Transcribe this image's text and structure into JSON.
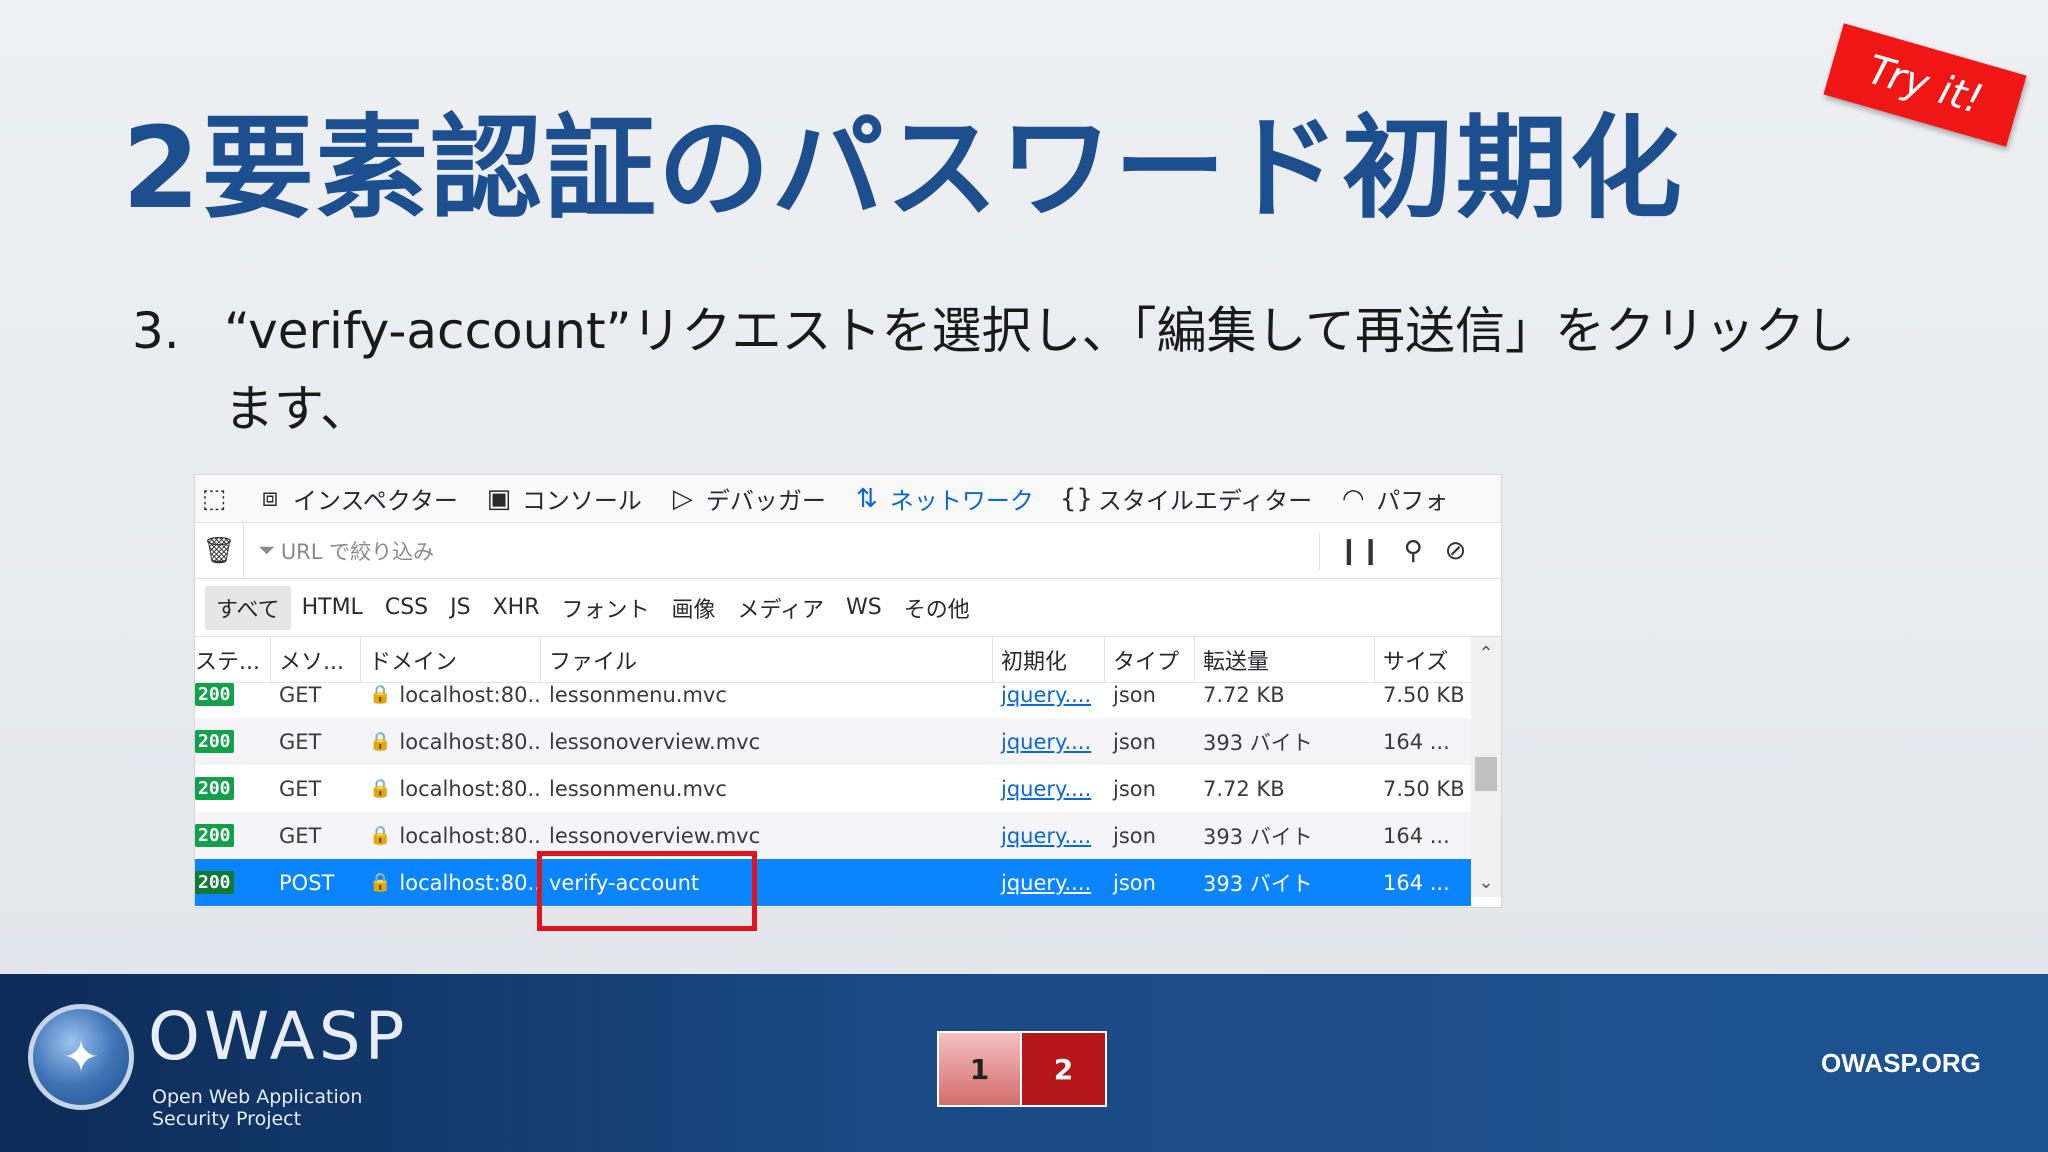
{
  "slide": {
    "title": "2要素認証のパスワード初期化",
    "badge": "Try it!",
    "step_number": "3.",
    "step_text": "“verify-account”リクエストを選択し、「編集して再送信」をクリックします、"
  },
  "devtools": {
    "tabs": [
      {
        "icon": "pick-icon",
        "label": ""
      },
      {
        "icon": "inspector-icon",
        "label": "インスペクター"
      },
      {
        "icon": "console-icon",
        "label": "コンソール"
      },
      {
        "icon": "debugger-icon",
        "label": "デバッガー"
      },
      {
        "icon": "network-icon",
        "label": "ネットワーク"
      },
      {
        "icon": "style-editor-icon",
        "label": "スタイルエディター"
      },
      {
        "icon": "performance-icon",
        "label": "パフォ"
      }
    ],
    "filter_placeholder": "URL で絞り込み",
    "type_filters": [
      "すべて",
      "HTML",
      "CSS",
      "JS",
      "XHR",
      "フォント",
      "画像",
      "メディア",
      "WS",
      "その他"
    ],
    "columns": [
      "ステ...",
      "メソ...",
      "ドメイン",
      "ファイル",
      "初期化",
      "タイプ",
      "転送量",
      "サイズ"
    ],
    "rows": [
      {
        "status": "200",
        "method": "GET",
        "domain": "localhost:80...",
        "file": "lessonmenu.mvc",
        "initiator": "jquery....",
        "type": "json",
        "transferred": "7.72 KB",
        "size": "7.50 KB"
      },
      {
        "status": "200",
        "method": "GET",
        "domain": "localhost:80...",
        "file": "lessonoverview.mvc",
        "initiator": "jquery....",
        "type": "json",
        "transferred": "393 バイト",
        "size": "164 ..."
      },
      {
        "status": "200",
        "method": "GET",
        "domain": "localhost:80...",
        "file": "lessonmenu.mvc",
        "initiator": "jquery....",
        "type": "json",
        "transferred": "7.72 KB",
        "size": "7.50 KB"
      },
      {
        "status": "200",
        "method": "GET",
        "domain": "localhost:80...",
        "file": "lessonoverview.mvc",
        "initiator": "jquery....",
        "type": "json",
        "transferred": "393 バイト",
        "size": "164 ..."
      },
      {
        "status": "200",
        "method": "POST",
        "domain": "localhost:80...",
        "file": "verify-account",
        "initiator": "jquery....",
        "type": "json",
        "transferred": "393 バイト",
        "size": "164 ..."
      }
    ]
  },
  "footer": {
    "logo_word": "OWASP",
    "logo_sub_1": "Open Web Application",
    "logo_sub_2": "Security Project",
    "pages": [
      "1",
      "2"
    ],
    "site": "OWASP.ORG"
  }
}
